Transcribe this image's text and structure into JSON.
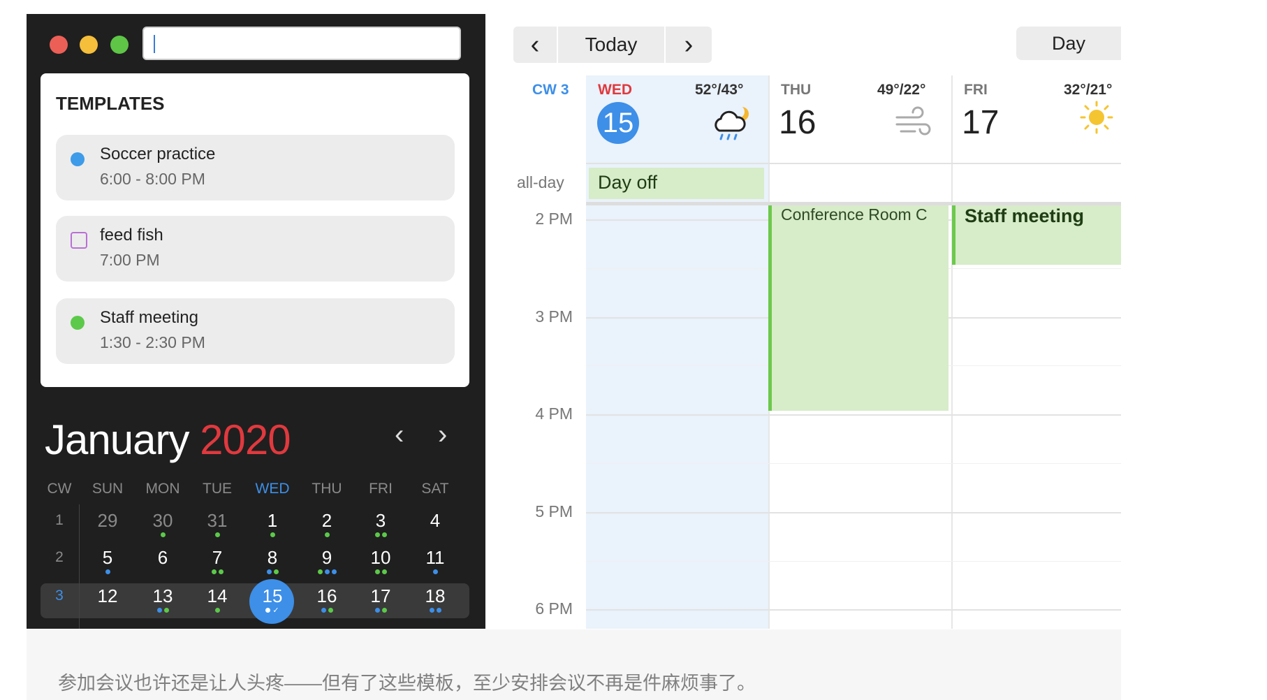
{
  "sidebar": {
    "search": {
      "value": ""
    },
    "templates": {
      "title": "TEMPLATES",
      "items": [
        {
          "name": "Soccer practice",
          "time": "6:00 - 8:00 PM",
          "type": "event",
          "color": "#3d9be9"
        },
        {
          "name": "feed fish",
          "time": "7:00 PM",
          "type": "reminder",
          "color": "#b96fd6"
        },
        {
          "name": "Staff meeting",
          "time": "1:30 - 2:30 PM",
          "type": "event",
          "color": "#5cc94a"
        }
      ]
    },
    "mini_calendar": {
      "month": "January",
      "year": "2020",
      "prev_icon": "chevron-left-icon",
      "next_icon": "chevron-right-icon",
      "headers": [
        "CW",
        "SUN",
        "MON",
        "TUE",
        "WED",
        "THU",
        "FRI",
        "SAT"
      ],
      "weeks": [
        {
          "cw": "1",
          "days": [
            {
              "d": "29",
              "dots": [],
              "muted": true
            },
            {
              "d": "30",
              "dots": [
                "g"
              ],
              "muted": true
            },
            {
              "d": "31",
              "dots": [
                "g"
              ],
              "muted": true
            },
            {
              "d": "1",
              "dots": [
                "g"
              ]
            },
            {
              "d": "2",
              "dots": [
                "g"
              ]
            },
            {
              "d": "3",
              "dots": [
                "g",
                "g"
              ]
            },
            {
              "d": "4",
              "dots": []
            }
          ]
        },
        {
          "cw": "2",
          "days": [
            {
              "d": "5",
              "dots": [
                "b"
              ]
            },
            {
              "d": "6",
              "dots": []
            },
            {
              "d": "7",
              "dots": [
                "g",
                "g"
              ]
            },
            {
              "d": "8",
              "dots": [
                "b",
                "g"
              ]
            },
            {
              "d": "9",
              "dots": [
                "g",
                "b",
                "b"
              ]
            },
            {
              "d": "10",
              "dots": [
                "g",
                "g"
              ]
            },
            {
              "d": "11",
              "dots": [
                "b"
              ]
            }
          ]
        },
        {
          "cw": "3",
          "days": [
            {
              "d": "12",
              "dots": []
            },
            {
              "d": "13",
              "dots": [
                "b",
                "g"
              ]
            },
            {
              "d": "14",
              "dots": [
                "g"
              ]
            },
            {
              "d": "15",
              "dots": [
                "w",
                "check"
              ],
              "today": true
            },
            {
              "d": "16",
              "dots": [
                "b",
                "g"
              ]
            },
            {
              "d": "17",
              "dots": [
                "b",
                "g"
              ]
            },
            {
              "d": "18",
              "dots": [
                "b",
                "b"
              ]
            }
          ]
        }
      ]
    }
  },
  "toolbar": {
    "prev_icon": "chevron-left-icon",
    "today": "Today",
    "next_icon": "chevron-right-icon",
    "view": "Day"
  },
  "week": {
    "cw": "CW 3",
    "days": [
      {
        "name": "WED",
        "date": "15",
        "temp": "52°/43°",
        "weather": "rain-cloud-moon-icon",
        "today": true
      },
      {
        "name": "THU",
        "date": "16",
        "temp": "49°/22°",
        "weather": "wind-icon"
      },
      {
        "name": "FRI",
        "date": "17",
        "temp": "32°/21°",
        "weather": "sun-icon"
      }
    ],
    "allday_label": "all-day",
    "allday_event": "Day off",
    "hours": [
      "2 PM",
      "3 PM",
      "4 PM",
      "5 PM",
      "6 PM"
    ],
    "events": [
      {
        "title": "Conference Room C",
        "day": "THU",
        "start": "2 PM",
        "end": "4 PM"
      },
      {
        "title": "Staff meeting",
        "day": "FRI",
        "start": "1:30 PM",
        "end": "2:30 PM"
      }
    ]
  },
  "colors": {
    "blue": "#3d8fe8",
    "green": "#5cc94a",
    "red": "#e0393e",
    "event_bg": "#d7ecc9"
  },
  "caption": "参加会议也许还是让人头疼——但有了这些模板，至少安排会议不再是件麻烦事了。"
}
